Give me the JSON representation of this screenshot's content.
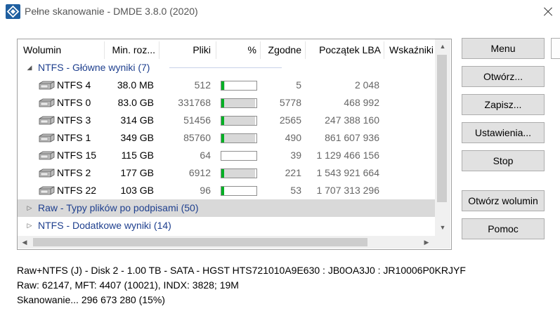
{
  "window": {
    "title": "Pełne skanowanie - DMDE 3.8.0 (2020)"
  },
  "columns": {
    "volume": "Wolumin",
    "min_size": "Min. roz...",
    "files": "Pliki",
    "percent": "%",
    "matching": "Zgodne",
    "start_lba": "Początek LBA",
    "flags": "Wskaźniki"
  },
  "groups": [
    {
      "label": "NTFS - Główne wyniki (7)",
      "expanded": true,
      "selected": false
    },
    {
      "label": "Raw - Typy plików po podpisami (50)",
      "expanded": false,
      "selected": true
    },
    {
      "label": "NTFS - Dodatkowe wyniki (14)",
      "expanded": false,
      "selected": false
    }
  ],
  "volumes": [
    {
      "name": "NTFS 4",
      "size": "38.0 MB",
      "files": "512",
      "progress": 0.1,
      "matching": "5",
      "lba": "2 048"
    },
    {
      "name": "NTFS 0",
      "size": "83.0 GB",
      "files": "331768",
      "progress": 0.95,
      "matching": "5778",
      "lba": "468 992"
    },
    {
      "name": "NTFS 3",
      "size": "314 GB",
      "files": "51456",
      "progress": 0.95,
      "matching": "2565",
      "lba": "247 388 160"
    },
    {
      "name": "NTFS 1",
      "size": "349 GB",
      "files": "85760",
      "progress": 0.95,
      "matching": "490",
      "lba": "861 607 936"
    },
    {
      "name": "NTFS 15",
      "size": "115 GB",
      "files": "64",
      "progress": 0.0,
      "matching": "39",
      "lba": "1 129 466 156"
    },
    {
      "name": "NTFS 2",
      "size": "177 GB",
      "files": "6912",
      "progress": 0.95,
      "matching": "221",
      "lba": "1 543 921 664"
    },
    {
      "name": "NTFS 22",
      "size": "103 GB",
      "files": "96",
      "progress": 0.04,
      "matching": "53",
      "lba": "1 707 313 296"
    }
  ],
  "buttons": {
    "menu": "Menu",
    "open": "Otwórz...",
    "save": "Zapisz...",
    "settings": "Ustawienia...",
    "stop": "Stop",
    "open_volume": "Otwórz wolumin",
    "help": "Pomoc"
  },
  "status": {
    "line1": "Raw+NTFS (J) - Disk 2 - 1.00 TB - SATA - HGST HTS721010A9E630 : JB0OA3J0 : JR10006P0KRJYF",
    "line2": "Raw: 62147, MFT: 4407 (10021), INDX: 3828; 19M",
    "line3": "Skanowanie... 296 673 280 (15%)"
  },
  "colors": {
    "progress_green": "#06b025",
    "group_text": "#1e3f8e",
    "selected_row": "#d9d9d9"
  }
}
